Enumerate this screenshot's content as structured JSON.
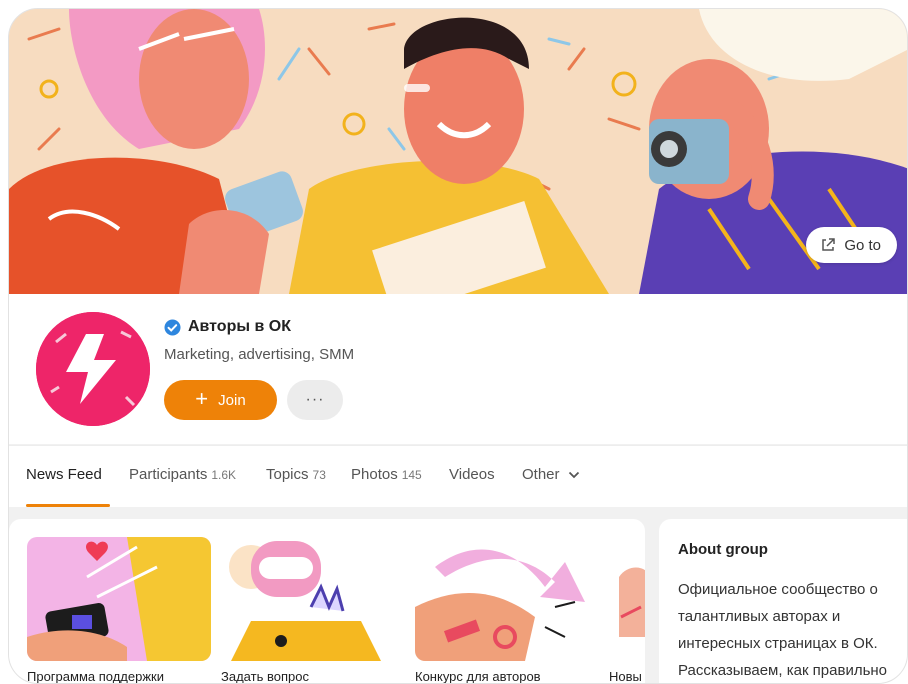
{
  "cover": {
    "goto_label": "Go to"
  },
  "group": {
    "title": "Авторы в ОК",
    "subtitle": "Marketing, advertising, SMM",
    "join_label": "Join",
    "more_label": "···"
  },
  "tabs": [
    {
      "label": "News Feed",
      "count": ""
    },
    {
      "label": "Participants",
      "count": "1.6K"
    },
    {
      "label": "Topics",
      "count": "73"
    },
    {
      "label": "Photos",
      "count": "145"
    },
    {
      "label": "Videos",
      "count": ""
    },
    {
      "label": "Other",
      "count": ""
    }
  ],
  "feed": {
    "tiles": [
      {
        "label": "Программа поддержки"
      },
      {
        "label": "Задать вопрос"
      },
      {
        "label": "Конкурс для авторов"
      },
      {
        "label": "Новы"
      }
    ]
  },
  "about": {
    "title": "About group",
    "text": "Официальное сообщество о талантливых авторах и интересных страницах в ОК. Рассказываем, как правильно выстроить"
  },
  "colors": {
    "accent": "#ee8208",
    "avatar_bg": "#ee2569",
    "verified": "#2e86de"
  }
}
